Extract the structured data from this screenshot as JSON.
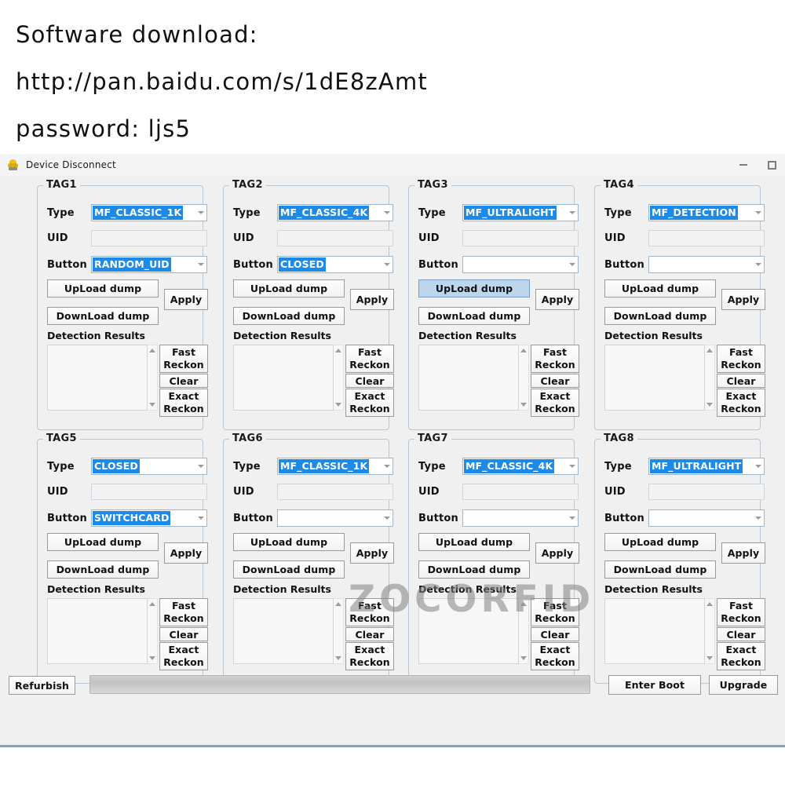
{
  "header_note": {
    "lines": [
      "Software download:",
      "http://pan.baidu.com/s/1dE8zAmt",
      "password: ljs5"
    ]
  },
  "window": {
    "title": "Device Disconnect",
    "app_icon": "device-icon",
    "minimize_label": "–",
    "maximize_label": "□",
    "watermark": "ZOCORFID",
    "accent_color": "#1c8ae8",
    "panel_border_color": "#b9c7d4",
    "highlight_color": "#bdd6ee",
    "background_color": "#f0f0f0"
  },
  "labels": {
    "type": "Type",
    "uid": "UID",
    "button": "Button",
    "upload": "UpLoad dump",
    "download": "DownLoad dump",
    "apply": "Apply",
    "detection_results": "Detection Results",
    "fast_reckon_line1": "Fast",
    "fast_reckon_line2": "Reckon",
    "clear": "Clear",
    "exact_reckon_line1": "Exact",
    "exact_reckon_line2": "Reckon"
  },
  "tags": [
    {
      "title": "TAG1",
      "type_value": "MF_CLASSIC_1K",
      "uid_value": "",
      "button_value": "RANDOM_UID",
      "upload_highlighted": false
    },
    {
      "title": "TAG2",
      "type_value": "MF_CLASSIC_4K",
      "uid_value": "",
      "button_value": "CLOSED",
      "upload_highlighted": false
    },
    {
      "title": "TAG3",
      "type_value": "MF_ULTRALIGHT",
      "uid_value": "",
      "button_value": "",
      "upload_highlighted": true
    },
    {
      "title": "TAG4",
      "type_value": "MF_DETECTION",
      "uid_value": "",
      "button_value": "",
      "upload_highlighted": false
    },
    {
      "title": "TAG5",
      "type_value": "CLOSED",
      "uid_value": "",
      "button_value": "SWITCHCARD",
      "upload_highlighted": false
    },
    {
      "title": "TAG6",
      "type_value": "MF_CLASSIC_1K",
      "uid_value": "",
      "button_value": "",
      "upload_highlighted": false
    },
    {
      "title": "TAG7",
      "type_value": "MF_CLASSIC_4K",
      "uid_value": "",
      "button_value": "",
      "upload_highlighted": false
    },
    {
      "title": "TAG8",
      "type_value": "MF_ULTRALIGHT",
      "uid_value": "",
      "button_value": "",
      "upload_highlighted": false
    }
  ],
  "bottom_bar": {
    "refurbish": "Refurbish",
    "progress_percent": 0,
    "enter_boot": "Enter Boot",
    "upgrade": "Upgrade"
  }
}
